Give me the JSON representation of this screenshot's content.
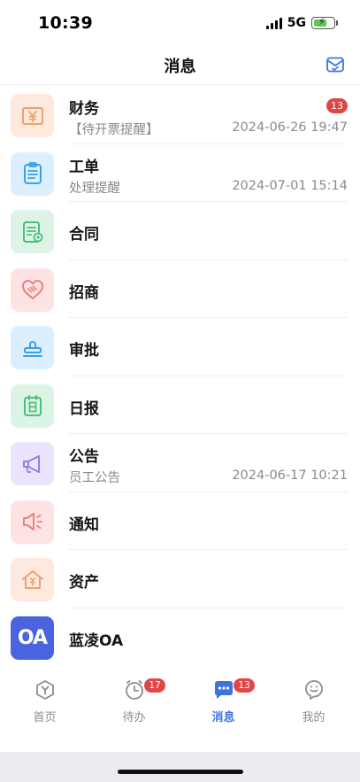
{
  "status_bar": {
    "time": "10:39",
    "network": "5G",
    "battery_level": 0.7
  },
  "header": {
    "title": "消息",
    "action_icon": "mail-check-icon"
  },
  "messages": [
    {
      "title": "财务",
      "subtitle": "【待开票提醒】",
      "time": "2024-06-26 19:47",
      "badge": "13",
      "icon": "yuan-voucher-icon",
      "icon_bg": "#fde9dd",
      "icon_color": "#f0a070"
    },
    {
      "title": "工单",
      "subtitle": "处理提醒",
      "time": "2024-07-01 15:14",
      "badge": "",
      "icon": "clipboard-icon",
      "icon_bg": "#dcefff",
      "icon_color": "#3aa0e8"
    },
    {
      "title": "合同",
      "subtitle": "",
      "time": "",
      "badge": "",
      "icon": "contract-icon",
      "icon_bg": "#ddf3e6",
      "icon_color": "#4cbf7d"
    },
    {
      "title": "招商",
      "subtitle": "",
      "time": "",
      "badge": "",
      "icon": "handshake-heart-icon",
      "icon_bg": "#fde3e3",
      "icon_color": "#ec7f80"
    },
    {
      "title": "审批",
      "subtitle": "",
      "time": "",
      "badge": "",
      "icon": "stamp-icon",
      "icon_bg": "#dcefff",
      "icon_color": "#3aa0e8"
    },
    {
      "title": "日报",
      "subtitle": "",
      "time": "",
      "badge": "",
      "icon": "daily-report-icon",
      "icon_bg": "#ddf3e6",
      "icon_color": "#4cbf7d"
    },
    {
      "title": "公告",
      "subtitle": "员工公告",
      "time": "2024-06-17 10:21",
      "badge": "",
      "icon": "megaphone-icon",
      "icon_bg": "#ebe4fb",
      "icon_color": "#9b7be6"
    },
    {
      "title": "通知",
      "subtitle": "",
      "time": "",
      "badge": "",
      "icon": "speaker-icon",
      "icon_bg": "#fde3e3",
      "icon_color": "#ec7f80"
    },
    {
      "title": "资产",
      "subtitle": "",
      "time": "",
      "badge": "",
      "icon": "asset-house-icon",
      "icon_bg": "#fde9dd",
      "icon_color": "#f0a070"
    },
    {
      "title": "蓝凌OA",
      "subtitle": "",
      "time": "",
      "badge": "",
      "icon": "oa-logo-icon",
      "icon_bg": "#4a64e0",
      "icon_color": "#ffffff",
      "icon_text": "OA"
    }
  ],
  "tabs": [
    {
      "label": "首页",
      "icon": "home-y-icon",
      "badge": "",
      "active": false
    },
    {
      "label": "待办",
      "icon": "clock-icon",
      "badge": "17",
      "active": false
    },
    {
      "label": "消息",
      "icon": "chat-bubble-icon",
      "badge": "13",
      "active": true
    },
    {
      "label": "我的",
      "icon": "profile-icon",
      "badge": "",
      "active": false
    }
  ],
  "colors": {
    "accent": "#3d74e0",
    "badge": "#e14646",
    "inactive": "#8c8c8c"
  }
}
